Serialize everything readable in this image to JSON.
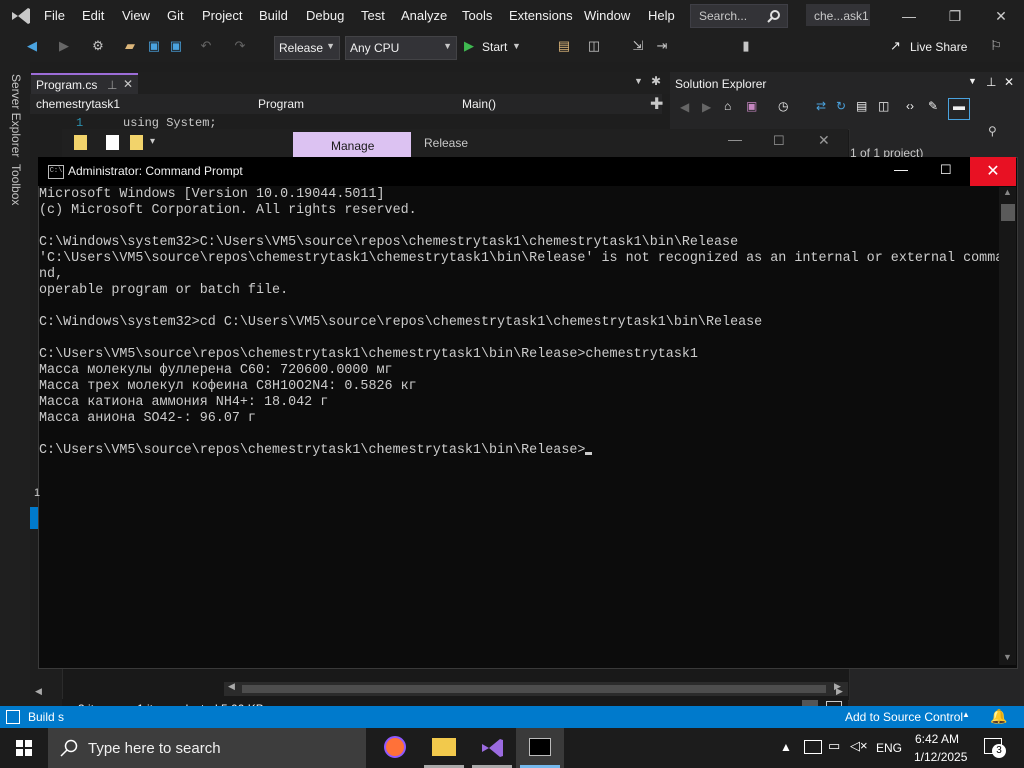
{
  "vs": {
    "menu": [
      "File",
      "Edit",
      "View",
      "Git",
      "Project",
      "Build",
      "Debug",
      "Test",
      "Analyze",
      "Tools",
      "Extensions",
      "Window",
      "Help"
    ],
    "search_placeholder": "Search...",
    "title_chip": "che...ask1",
    "toolbar": {
      "config": "Release",
      "platform": "Any CPU",
      "start": "Start",
      "live_share": "Live Share"
    },
    "doc_tab": "Program.cs",
    "nav": {
      "project": "chemestrytask1",
      "class": "Program",
      "member": "Main()"
    },
    "editor": {
      "line_number": "1",
      "code": "using System;"
    },
    "left_rail": {
      "server_explorer": "Server Explorer",
      "toolbox": "Toolbox"
    },
    "solution_explorer": {
      "title": "Solution Explorer",
      "hint": "1 of 1 project)"
    },
    "status": {
      "build": "Build s",
      "source_control": "Add to Source Control",
      "left_digit": "1"
    }
  },
  "explorer": {
    "tabs": {
      "manage": "Manage",
      "release": "Release"
    },
    "status": {
      "items": "3 items",
      "selected": "1 item selected  5.00 KB"
    }
  },
  "cmd": {
    "title": "Administrator: Command Prompt",
    "lines": [
      "Microsoft Windows [Version 10.0.19044.5011]",
      "(c) Microsoft Corporation. All rights reserved.",
      "",
      "C:\\Windows\\system32>C:\\Users\\VM5\\source\\repos\\chemestrytask1\\chemestrytask1\\bin\\Release",
      "'C:\\Users\\VM5\\source\\repos\\chemestrytask1\\chemestrytask1\\bin\\Release' is not recognized as an internal or external comma",
      "nd,",
      "operable program or batch file.",
      "",
      "C:\\Windows\\system32>cd C:\\Users\\VM5\\source\\repos\\chemestrytask1\\chemestrytask1\\bin\\Release",
      "",
      "C:\\Users\\VM5\\source\\repos\\chemestrytask1\\chemestrytask1\\bin\\Release>chemestrytask1",
      "Масса молекулы фуллерена C60: 720600.0000 мг",
      "Масса трех молекул кофеина C8H10O2N4: 0.5826 кг",
      "Масса катиона аммония NH4+: 18.042 г",
      "Масса аниона SO42-: 96.07 г",
      "",
      "C:\\Users\\VM5\\source\\repos\\chemestrytask1\\chemestrytask1\\bin\\Release>"
    ]
  },
  "taskbar": {
    "search_placeholder": "Type here to search",
    "lang": "ENG",
    "time": "6:42 AM",
    "date": "1/12/2025",
    "notification_count": "3"
  },
  "colors": {
    "vs_accent": "#007acc",
    "cmd_close": "#e81123",
    "manage_tab": "#dcc2f2"
  }
}
